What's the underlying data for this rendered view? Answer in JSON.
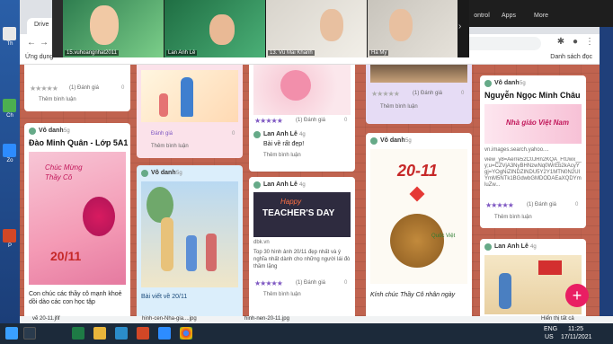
{
  "desktop": {
    "labels": [
      "Th",
      "Ch",
      "Zo",
      "P"
    ]
  },
  "browser": {
    "tab_title": "Drive",
    "bookmarks_apps": "Ứng dụng",
    "bookmarks_right": "Danh sách đọc"
  },
  "zoom": {
    "participants": [
      {
        "name": "15.vuhoangnhat2011"
      },
      {
        "name": "Lan Anh Lê"
      },
      {
        "name": "13. Vũ Mai Khanh"
      },
      {
        "name": "Hà My"
      }
    ],
    "right_items": [
      "ontrol",
      "Apps",
      "More"
    ]
  },
  "board": {
    "col1": {
      "card1": {
        "rating_label": "(1) Đánh giá",
        "comments": "0",
        "add_comment": "Thêm bình luận"
      },
      "card2": {
        "author": "Vô danh",
        "time": "5g",
        "title": "Đào Minh Quân - Lớp 5A1",
        "img_text1": "Chúc Mừng Thầy Cô",
        "img_text2": "20/11",
        "body": "Con chúc các thầy cô mạnh khoẻ dồi dào các con học tập"
      }
    },
    "col2": {
      "card1": {
        "rating_label": "Đánh giá",
        "comments": "0",
        "add_comment": "Thêm bình luận"
      },
      "card2": {
        "author": "Vô danh",
        "time": "5g",
        "title": "Bài viết về 20/11"
      }
    },
    "col3": {
      "card1": {
        "author": "Lan Anh Lê",
        "time": "4g",
        "text": "Bài về rất đẹp!",
        "rating_label": "(1) Đánh giá",
        "comments": "0",
        "add_comment": "Thêm bình luận"
      },
      "card2": {
        "author": "Lan Anh Lê",
        "time": "4g",
        "img_text1": "Happy",
        "img_text2": "TEACHER'S DAY",
        "source": "dbk.vn",
        "body": "Top 30 hình ảnh 20/11 đẹp nhất và ý nghĩa nhất dành cho những người lái đò thầm lặng",
        "rating_label": "(1) Đánh giá",
        "comments": "0",
        "add_comment": "Thêm bình luận"
      }
    },
    "col4": {
      "card1": {
        "rating_label": "(1) Đánh giá",
        "comments": "0",
        "add_comment": "Thêm bình luận"
      },
      "card2": {
        "author": "Vô danh",
        "time": "5g",
        "img_text": "20-11",
        "img_caption": "Quốc Việt",
        "body": "Kính chúc Thầy Cô nhân ngày"
      }
    },
    "col5": {
      "card1": {
        "author": "Vô danh",
        "time": "5g",
        "title": "Nguyễn Ngọc Minh Châu",
        "img_text1": "Nhà giáo Việt Nam",
        "source": "vn.images.search.yahoo....",
        "url_text": "view_y8=Aerre52C0JRn2KQA_FtUwx__y;u=CZVjA3NyBHNzwNq0WrEb2kAcyYgj=YOgNiZINDZINDU5Y2Y1MTN0N2UIYmM5NTk1BGdwbGMDODAEaXQDYmluZw...",
        "rating_label": "(1) Đánh giá",
        "comments": "0",
        "add_comment": "Thêm bình luận"
      },
      "card2": {
        "author": "Lan Anh Lê",
        "time": "4g"
      }
    },
    "fab": "+"
  },
  "downloads": [
    {
      "name": "vẽ 20-11.jfif"
    },
    {
      "name": "hinh-cen-Nha-gia....jpg"
    },
    {
      "name": "hinh-nen-20-11.jpg"
    }
  ],
  "downloads_right": "Hiển thị tất cả",
  "taskbar": {
    "lang": "ENG",
    "locale": "US",
    "time": "11:25",
    "date": "17/11/2021"
  },
  "colors": {
    "board_bg": "#c0634f",
    "accent_purple": "#7e57c2",
    "fab": "#e91e63"
  }
}
